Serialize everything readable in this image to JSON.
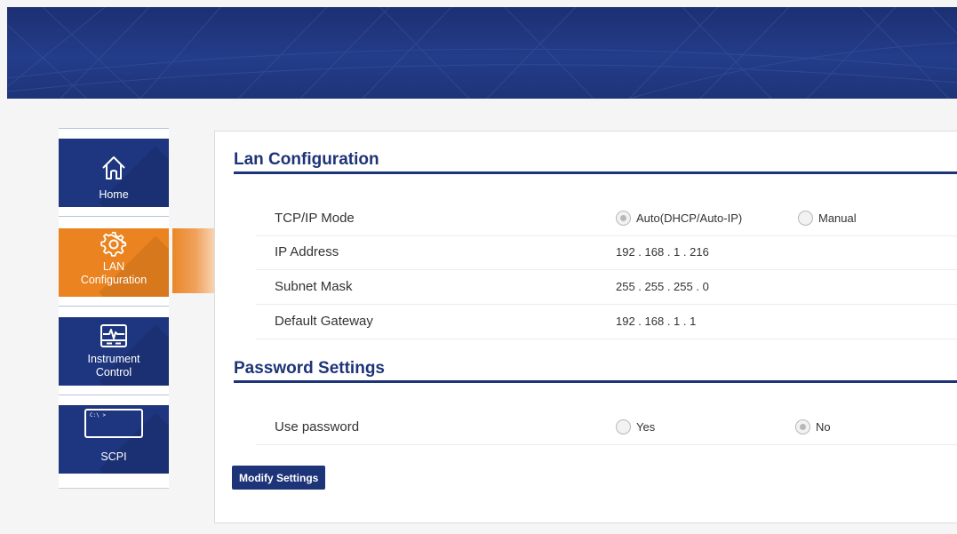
{
  "sidebar": {
    "items": [
      {
        "label": "Home",
        "icon": "home-icon"
      },
      {
        "label": "LAN Configuration",
        "icon": "gear-icon"
      },
      {
        "label": "Instrument Control",
        "icon": "monitor-pulse-icon"
      },
      {
        "label": "SCPI",
        "icon": "terminal-icon",
        "icon_text": "C:\\ >"
      }
    ]
  },
  "lan": {
    "title": "Lan Configuration",
    "rows": [
      {
        "label": "TCP/IP Mode",
        "options": [
          "Auto(DHCP/Auto-IP)",
          "Manual"
        ],
        "selected": "Auto(DHCP/Auto-IP)"
      },
      {
        "label": "IP Address",
        "value": "192 . 168 . 1 . 216"
      },
      {
        "label": "Subnet Mask",
        "value": "255 . 255 . 255 . 0"
      },
      {
        "label": "Default Gateway",
        "value": "192 . 168 . 1 . 1"
      }
    ]
  },
  "password": {
    "title": "Password Settings",
    "row": {
      "label": "Use password",
      "options": [
        "Yes",
        "No"
      ],
      "selected": "No"
    }
  },
  "modify_button": "Modify Settings",
  "colors": {
    "navy": "#1e3478",
    "accent_orange": "#ea8320"
  }
}
